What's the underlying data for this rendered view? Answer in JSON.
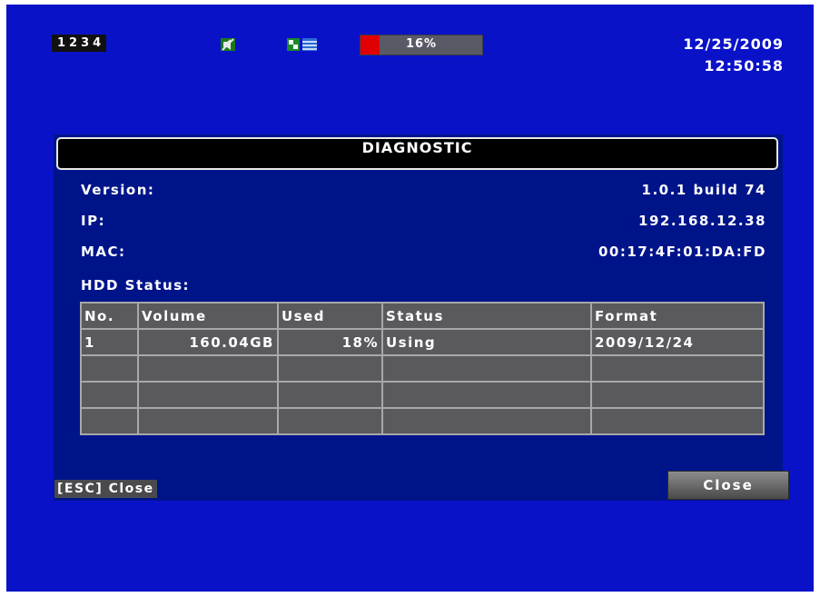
{
  "status_bar": {
    "channels": [
      "1",
      "2",
      "3",
      "4"
    ],
    "hdd_usage_label": "16%",
    "hdd_usage_fraction": 0.16,
    "hdd_fill_color": "#e00000",
    "record_icon": "record-sound-icon",
    "network_icon": "network-connection-icon",
    "date": "12/25/2009",
    "time": "12:50:58"
  },
  "dialog": {
    "title": "DIAGNOSTIC",
    "fields": [
      {
        "label": "Version:",
        "value": "1.0.1 build 74"
      },
      {
        "label": "IP:",
        "value": "192.168.12.38"
      },
      {
        "label": "MAC:",
        "value": "00:17:4F:01:DA:FD"
      }
    ],
    "hdd_status_label": "HDD Status:",
    "table": {
      "headers": [
        "No.",
        "Volume",
        "Used",
        "Status",
        "Format"
      ],
      "rows": [
        [
          "1",
          "160.04GB",
          "18%",
          "Using",
          "2009/12/24"
        ],
        [
          "",
          "",
          "",
          "",
          ""
        ],
        [
          "",
          "",
          "",
          "",
          ""
        ],
        [
          "",
          "",
          "",
          "",
          ""
        ]
      ]
    },
    "esc_hint": "[ESC] Close",
    "close_button": "Close"
  },
  "colors": {
    "screen_bg": "#0a12c8",
    "dialog_bg": "#00148a",
    "table_cell": "#5a5a5e"
  }
}
